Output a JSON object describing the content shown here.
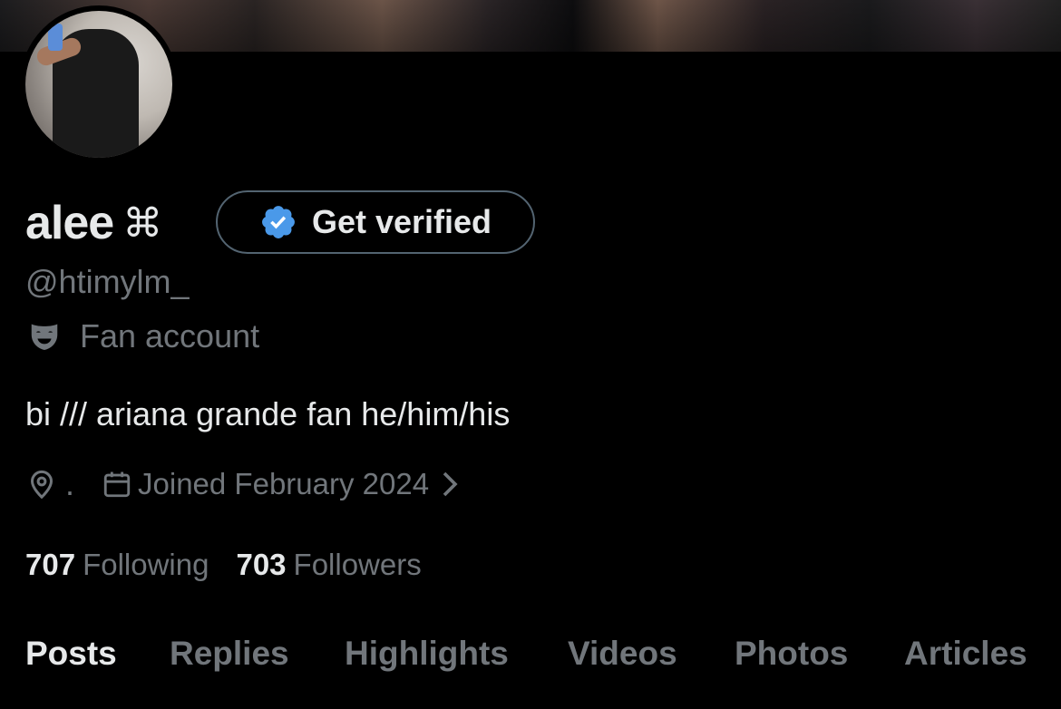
{
  "profile": {
    "display_name": "alee",
    "name_symbol": "⌘",
    "verify_label": "Get verified",
    "handle": "@htimylm_",
    "category": "Fan account",
    "bio": "bi /// ariana grande fan he/him/his",
    "location": ".",
    "joined": "Joined February 2024"
  },
  "stats": {
    "following_count": "707",
    "following_label": "Following",
    "followers_count": "703",
    "followers_label": "Followers"
  },
  "tabs": [
    {
      "label": "Posts",
      "active": true
    },
    {
      "label": "Replies",
      "active": false
    },
    {
      "label": "Highlights",
      "active": false
    },
    {
      "label": "Videos",
      "active": false
    },
    {
      "label": "Photos",
      "active": false
    },
    {
      "label": "Articles",
      "active": false
    }
  ],
  "icons": {
    "verify": "verified-badge-icon",
    "category": "theater-mask-icon",
    "location": "location-pin-icon",
    "calendar": "calendar-icon",
    "chevron": "chevron-right-icon"
  },
  "colors": {
    "background": "#000000",
    "primary_text": "#e7e9ea",
    "secondary_text": "#71767b",
    "verified_blue": "#4a99e9",
    "border": "#536471"
  }
}
